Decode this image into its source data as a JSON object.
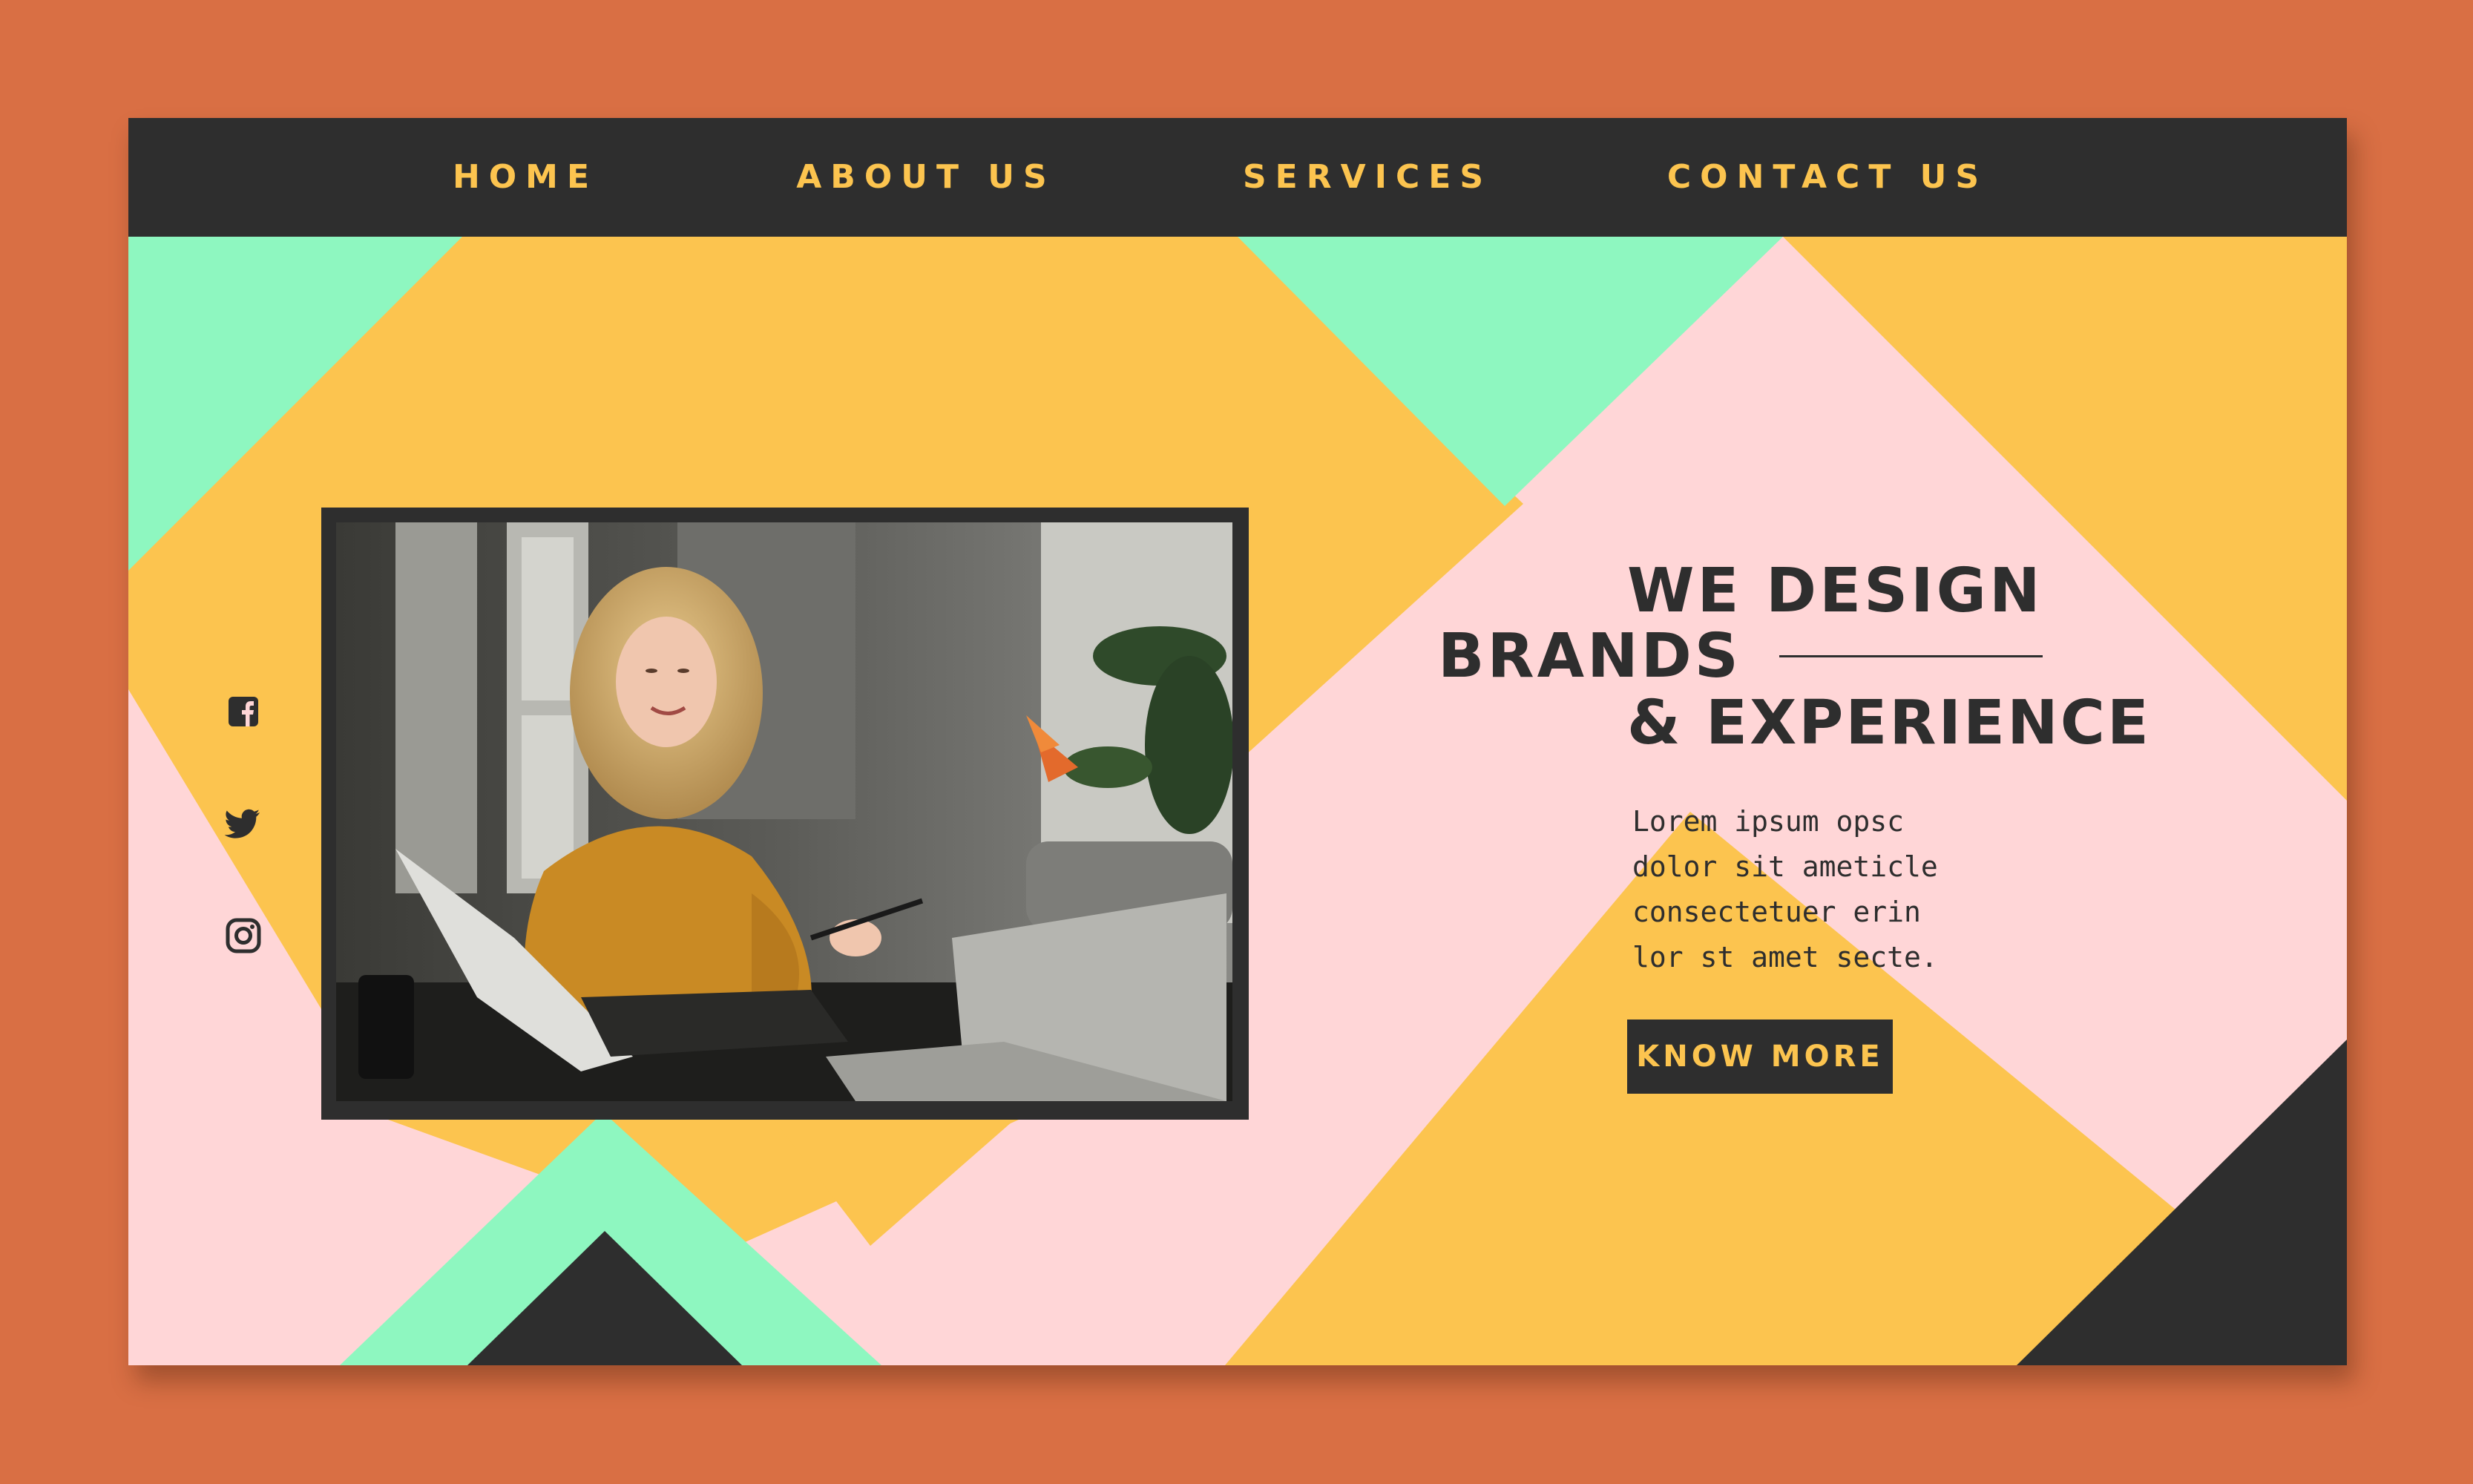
{
  "nav": {
    "items": [
      {
        "label": "HOME"
      },
      {
        "label": "ABOUT US"
      },
      {
        "label": "SERVICES"
      },
      {
        "label": "CONTACT US"
      }
    ]
  },
  "social": [
    "facebook-icon",
    "twitter-icon",
    "instagram-icon"
  ],
  "hero": {
    "line1": "WE DESIGN",
    "line2": "BRANDS",
    "line3": "& EXPERIENCE",
    "body": [
      "Lorem ipsum opsc",
      "dolor sit ameticle",
      "consectetuer erin",
      "lor st amet secte."
    ],
    "cta_label": "KNOW MORE"
  },
  "colors": {
    "outer_background": "#d96f44",
    "dark": "#2e2e2e",
    "yellow": "#fcc44f",
    "mint": "#8ef7c0",
    "pink": "#ffd6d7"
  }
}
